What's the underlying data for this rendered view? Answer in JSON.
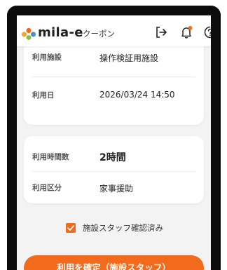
{
  "header": {
    "brand": "mila-e",
    "subtitle": "クーポン",
    "icons": [
      "logout-icon",
      "bell-icon",
      "help-icon"
    ],
    "notification_dot_color": "#f26a1b"
  },
  "usage_card": {
    "facility_label": "利用施設",
    "facility_value": "操作検証用施設",
    "date_label": "利用日",
    "date_value": "2026/03/24 14:50"
  },
  "detail_card": {
    "hours_label": "利用時間数",
    "hours_value": "2時間",
    "category_label": "利用区分",
    "category_value": "家事援助"
  },
  "confirmation": {
    "checked": true,
    "label": "施設スタッフ確認済み"
  },
  "actions": {
    "confirm_button": "利用を確定（施設スタッフ）"
  },
  "colors": {
    "accent": "#f26a1b",
    "background": "#f3f3f3",
    "card": "#ffffff"
  }
}
